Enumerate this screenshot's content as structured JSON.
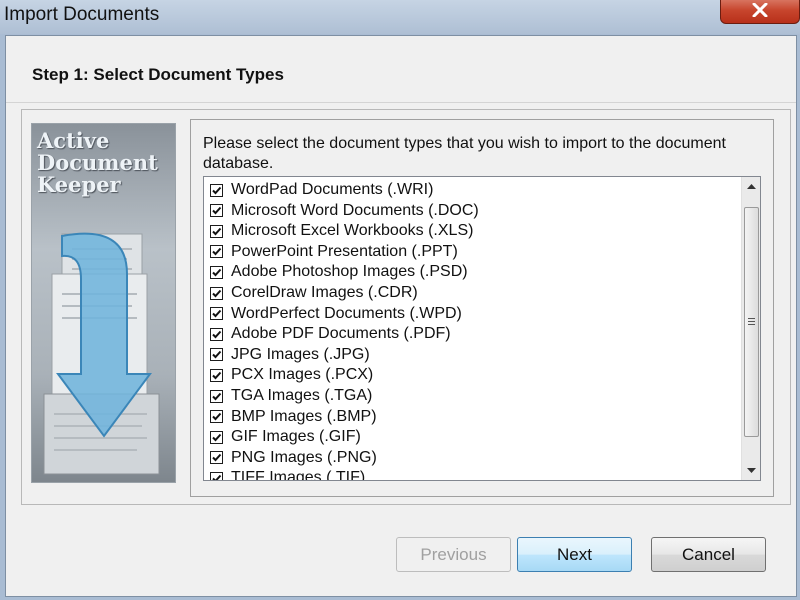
{
  "window": {
    "title": "Import Documents"
  },
  "header": {
    "step_title": "Step 1: Select Document Types"
  },
  "banner": {
    "line1": "Active",
    "line2": "Document",
    "line3": "Keeper"
  },
  "instructions": "Please select the document types that you wish to import to the document database.",
  "document_types": [
    {
      "label": "WordPad Documents (.WRI)",
      "checked": true
    },
    {
      "label": "Microsoft Word Documents (.DOC)",
      "checked": true
    },
    {
      "label": "Microsoft Excel Workbooks (.XLS)",
      "checked": true
    },
    {
      "label": "PowerPoint Presentation (.PPT)",
      "checked": true
    },
    {
      "label": "Adobe Photoshop Images (.PSD)",
      "checked": true
    },
    {
      "label": "CorelDraw Images (.CDR)",
      "checked": true
    },
    {
      "label": "WordPerfect Documents (.WPD)",
      "checked": true
    },
    {
      "label": "Adobe PDF Documents (.PDF)",
      "checked": true
    },
    {
      "label": "JPG Images (.JPG)",
      "checked": true
    },
    {
      "label": "PCX Images (.PCX)",
      "checked": true
    },
    {
      "label": "TGA Images (.TGA)",
      "checked": true
    },
    {
      "label": "BMP Images (.BMP)",
      "checked": true
    },
    {
      "label": "GIF Images (.GIF)",
      "checked": true
    },
    {
      "label": "PNG Images (.PNG)",
      "checked": true
    },
    {
      "label": "TIFF Images (.TIF)",
      "checked": true
    }
  ],
  "buttons": {
    "previous": "Previous",
    "next": "Next",
    "cancel": "Cancel"
  },
  "colors": {
    "primary_button_border": "#3c7fb1",
    "close_button": "#c7452d"
  }
}
